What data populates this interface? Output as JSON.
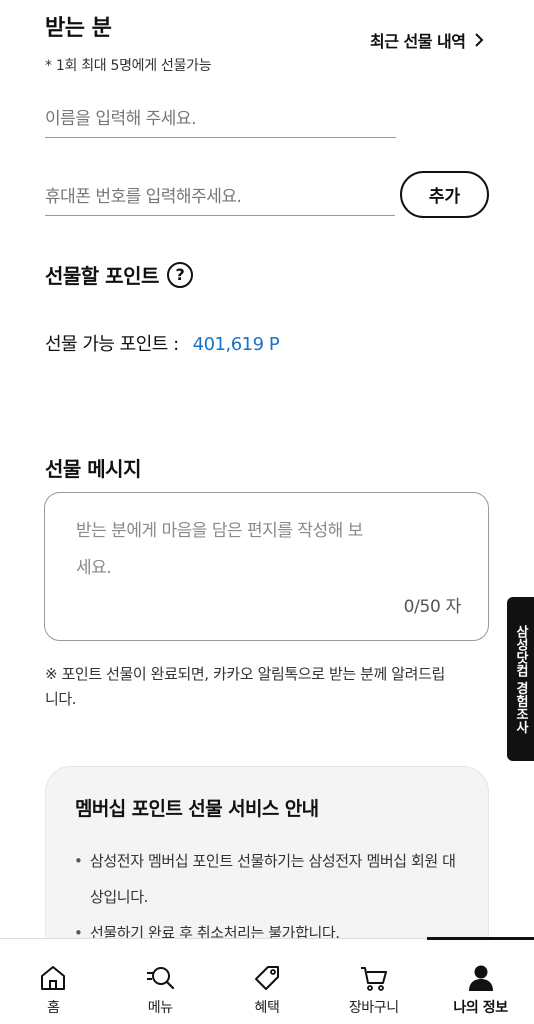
{
  "recipient": {
    "title": "받는 분",
    "recent_link": "최근 선물 내역",
    "limit_note": "* 1회 최대 5명에게 선물가능",
    "name_placeholder": "이름을 입력해 주세요.",
    "phone_placeholder": "휴대폰 번호를 입력해주세요.",
    "add_button": "추가"
  },
  "points": {
    "title": "선물할 포인트",
    "help_icon": "question-circle",
    "available_label": "선물 가능 포인트 :",
    "available_value": "401,619 P",
    "value_color": "#1a73c8"
  },
  "message": {
    "title": "선물 메시지",
    "placeholder": "받는 분에게 마음을 담은 편지를 작성해 보세요.",
    "char_count": "0/50 자"
  },
  "kakao_note": "※ 포인트 선물이 완료되면, 카카오 알림톡으로 받는 분께 알려드립니다.",
  "info_card": {
    "title": "멤버십 포인트 선물 서비스 안내",
    "items": [
      "삼성전자 멤버십 포인트 선물하기는 삼성전자 멤버십 회원 대상입니다.",
      "선물하기 완료 후 취소처리는 불가합니다."
    ]
  },
  "survey_tab": "삼성닷컴 경험조사",
  "bottom_nav": {
    "items": [
      {
        "label": "홈",
        "icon": "home-icon"
      },
      {
        "label": "메뉴",
        "icon": "menu-search-icon"
      },
      {
        "label": "혜택",
        "icon": "tag-icon"
      },
      {
        "label": "장바구니",
        "icon": "cart-icon"
      },
      {
        "label": "나의 정보",
        "icon": "user-icon",
        "active": true
      }
    ]
  }
}
